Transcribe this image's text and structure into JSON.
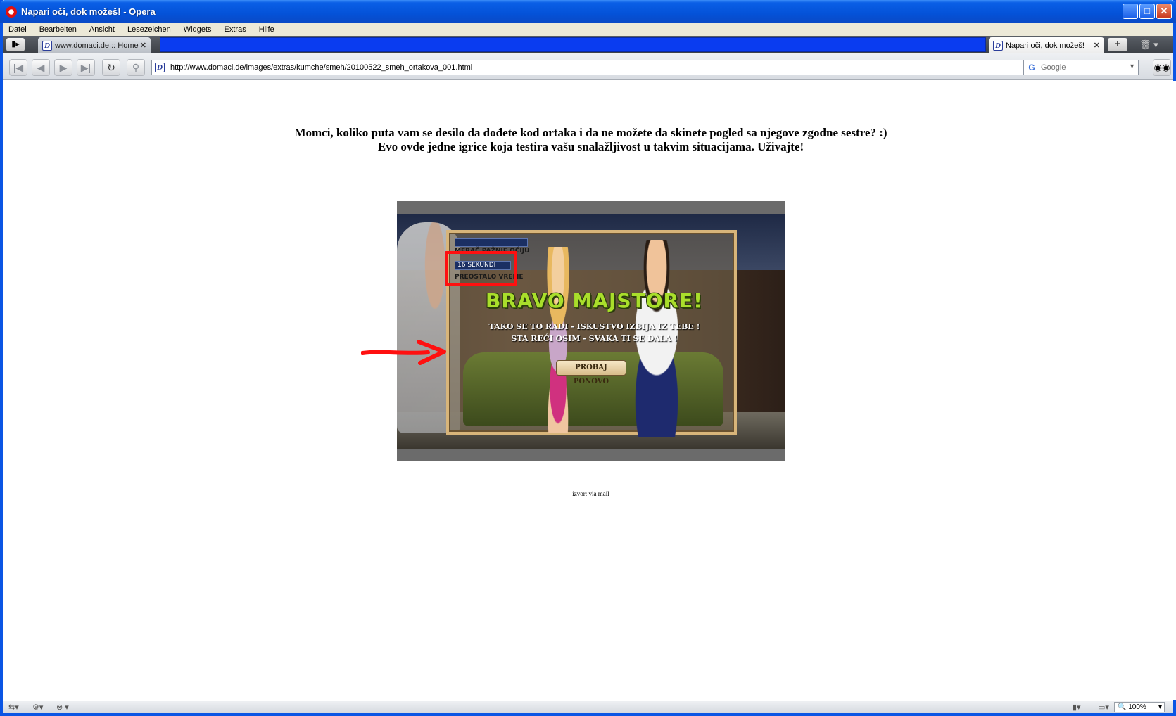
{
  "window": {
    "title": "Napari oči, dok možeš! - Opera",
    "controls": {
      "minimize": "_",
      "maximize": "□",
      "close": "✕"
    }
  },
  "menu": [
    "Datei",
    "Bearbeiten",
    "Ansicht",
    "Lesezeichen",
    "Widgets",
    "Extras",
    "Hilfe"
  ],
  "tabs": [
    {
      "label": "www.domaci.de :: Home",
      "favicon": "D",
      "active": false
    },
    {
      "label": "Napari oči, dok možeš!",
      "favicon": "D",
      "active": true
    }
  ],
  "toolbar": {
    "url": "http://www.domaci.de/images/extras/kumche/smeh/20100522_smeh_ortakova_001.html",
    "search_placeholder": "Google",
    "buttons": [
      "rewind-icon",
      "back-icon",
      "forward-icon",
      "fast-forward-icon",
      "reload-icon",
      "security-icon"
    ]
  },
  "page": {
    "headline_line1": "Momci, koliko puta vam se desilo da dođete kod ortaka i da ne možete da skinete pogled sa njegove zgodne sestre? :)",
    "headline_line2": "Evo ovde jedne igrice koja testira vašu snalažljivost u takvim situacijama. Uživajte!",
    "source": "izvor: via mail",
    "game": {
      "meter_label": "MERAČ PAŽNJE OČIJU",
      "timer_value": "16 SEKUNDI",
      "timer_label": "PREOSTALO VREME",
      "headline": "BRAVO MAJSTORE!",
      "message_line1": "TAKO SE TO RADI - ISKUSTVO IZBIJA IZ TEBE !",
      "message_line2": "STA REĆI OSIM - SVAKA TI SE DALA !",
      "retry_label": "PROBAJ PONOVO"
    }
  },
  "status": {
    "zoom": "100%"
  },
  "colors": {
    "titlebar": "#0452d8",
    "highlight": "#ff1010",
    "bravo": "#a9de2b"
  }
}
